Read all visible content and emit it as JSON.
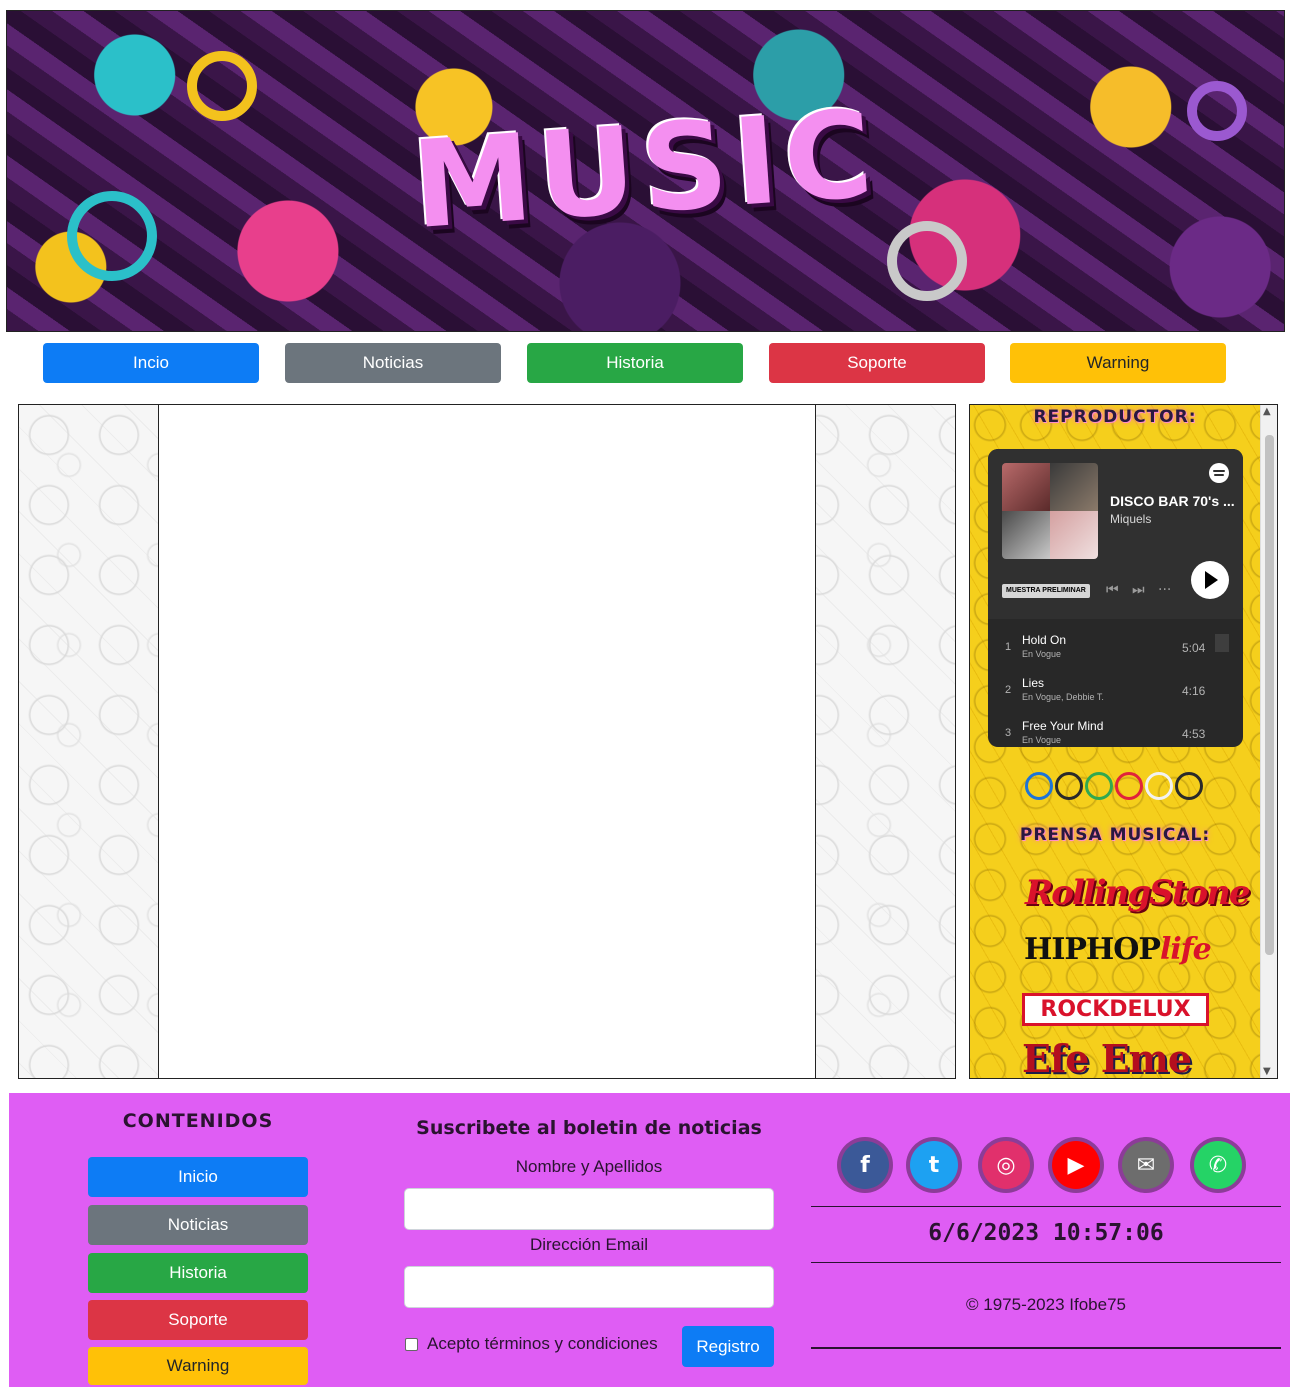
{
  "banner": {
    "title": "MUSIC"
  },
  "nav": [
    {
      "label": "Incio",
      "color": "#0d7cf5"
    },
    {
      "label": "Noticias",
      "color": "#6c757d"
    },
    {
      "label": "Historia",
      "color": "#28a745"
    },
    {
      "label": "Soporte",
      "color": "#dc3545"
    },
    {
      "label": "Warning",
      "color": "#ffc107"
    }
  ],
  "sidebar": {
    "player_heading": "REPRODUCTOR:",
    "press_heading": "PRENSA MUSICAL:",
    "spotify": {
      "playlist_title": "DISCO BAR 70's ...",
      "owner": "Miquels",
      "preview_label": "MUESTRA PRELIMINAR",
      "tracks": [
        {
          "num": "1",
          "name": "Hold On",
          "artist": "En Vogue",
          "duration": "5:04"
        },
        {
          "num": "2",
          "name": "Lies",
          "artist": "En Vogue, Debbie T.",
          "duration": "4:16"
        },
        {
          "num": "3",
          "name": "Free Your Mind",
          "artist": "En Vogue",
          "duration": "4:53"
        }
      ]
    },
    "press_logos": {
      "rolling": "RollingStone",
      "hiphop_a": "HIPHOP",
      "hiphop_b": "life",
      "rockdelux": "ROCKDELUX",
      "efeeme": "Efe Eme"
    }
  },
  "footer": {
    "contents_heading": "CONTENIDOS",
    "nav": [
      {
        "label": "Inicio"
      },
      {
        "label": "Noticias"
      },
      {
        "label": "Historia"
      },
      {
        "label": "Soporte"
      },
      {
        "label": "Warning"
      }
    ],
    "newsletter": {
      "title": "Suscribete al boletin de noticias",
      "name_label": "Nombre y Apellidos",
      "name_value": "",
      "email_label": "Dirección Email",
      "email_value": "",
      "terms_label": "Acepto términos y condiciones",
      "register_label": "Registro"
    },
    "social": [
      {
        "icon": "facebook-icon",
        "glyph": "f",
        "color": "#3b5998"
      },
      {
        "icon": "twitter-icon",
        "glyph": "t",
        "color": "#1da1f2"
      },
      {
        "icon": "instagram-icon",
        "glyph": "◎",
        "color": "#e1306c"
      },
      {
        "icon": "youtube-icon",
        "glyph": "▶",
        "color": "#ff0000"
      },
      {
        "icon": "mail-icon",
        "glyph": "✉",
        "color": "#6d6d6d"
      },
      {
        "icon": "whatsapp-icon",
        "glyph": "✆",
        "color": "#25d366"
      }
    ],
    "clock": "6/6/2023 10:57:06",
    "copyright": "© 1975-2023 Ifobe75"
  }
}
